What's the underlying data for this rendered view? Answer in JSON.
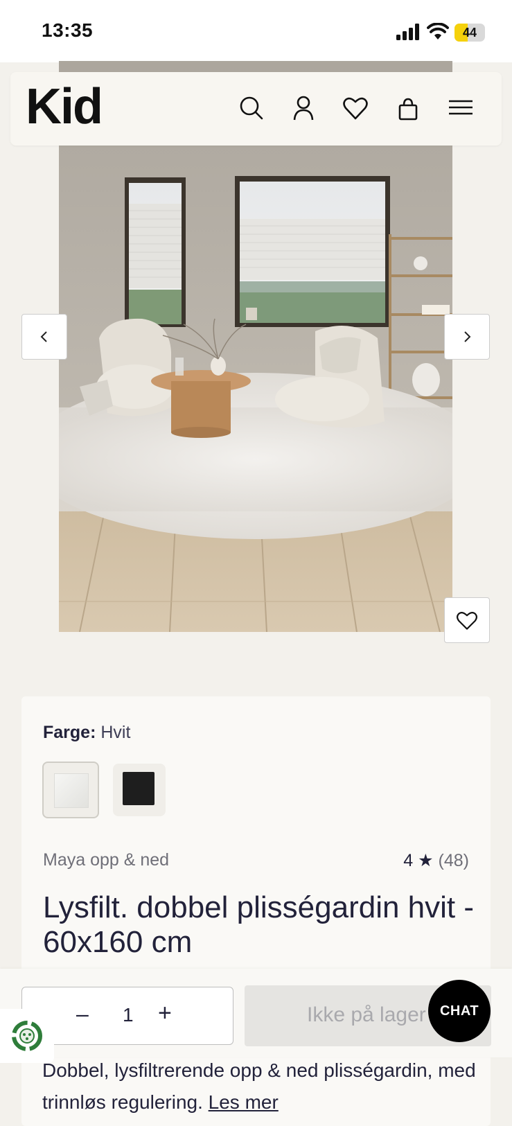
{
  "status_bar": {
    "time": "13:35",
    "battery": "44",
    "battery_level": 0.44
  },
  "header": {
    "logo": "Kid",
    "icons": [
      "search-icon",
      "account-icon",
      "wishlist-icon",
      "bag-icon",
      "menu-icon"
    ]
  },
  "gallery": {
    "prev_icon": "chevron-left-icon",
    "next_icon": "chevron-right-icon",
    "wishlist_icon": "heart-icon"
  },
  "product": {
    "color_label": "Farge:",
    "color_value": "Hvit",
    "swatches": [
      "Hvit",
      "Svart"
    ],
    "brand": "Maya opp & ned",
    "rating_value": "4",
    "rating_star": "★",
    "rating_count": "(48)",
    "title": "Lysfilt. dobbel plisségardin hvit - 60x160 cm",
    "description": "Dobbel, lysfiltrerende opp & ned plisségardin, med trinnløs regulering.",
    "read_more": "Les mer"
  },
  "bottom_bar": {
    "minus": "–",
    "quantity": "1",
    "plus": "+",
    "cart_button": "Ikke på lager"
  },
  "chat": {
    "label": "CHAT"
  },
  "colors": {
    "background": "#f3f1ec",
    "card": "#faf9f6",
    "text": "#22223a",
    "chat": "#000000"
  }
}
